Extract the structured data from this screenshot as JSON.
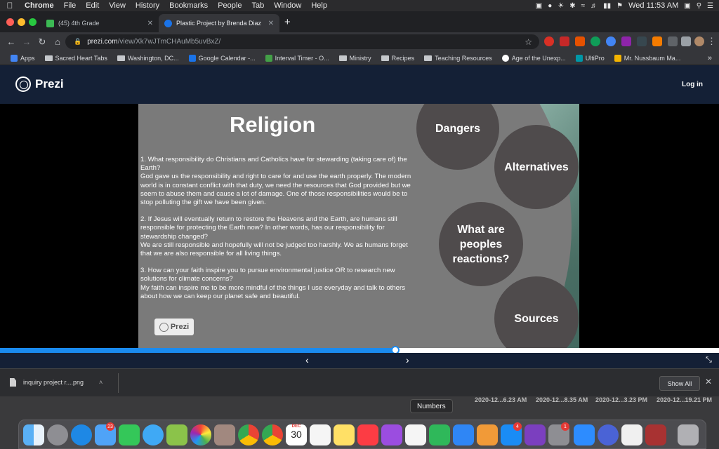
{
  "menubar": {
    "items": [
      "Chrome",
      "File",
      "Edit",
      "View",
      "History",
      "Bookmarks",
      "People",
      "Tab",
      "Window",
      "Help"
    ],
    "clock": "Wed 11:53 AM"
  },
  "tabs": [
    {
      "title": "(45) 4th Grade",
      "active": false,
      "color": "#3cba54"
    },
    {
      "title": "Plastic Project by Brenda Diaz",
      "active": true,
      "color": "#1a73e8"
    }
  ],
  "new_tab": "+",
  "address": {
    "host": "prezi.com",
    "path": "/view/Xk7wJTmCHAuMb5uvBxZ/"
  },
  "bookmarks": [
    {
      "label": "Apps",
      "icon": "apps-grid"
    },
    {
      "label": "Sacred Heart Tabs",
      "icon": "folder"
    },
    {
      "label": "Washington, DC...",
      "icon": "folder"
    },
    {
      "label": "Google Calendar -...",
      "icon": "calendar"
    },
    {
      "label": "Interval Timer - O...",
      "icon": "timer"
    },
    {
      "label": "Ministry",
      "icon": "folder"
    },
    {
      "label": "Recipes",
      "icon": "folder"
    },
    {
      "label": "Teaching Resources",
      "icon": "folder"
    },
    {
      "label": "Age of the Unexp...",
      "icon": "wikipedia"
    },
    {
      "label": "UltiPro",
      "icon": "ultipro"
    },
    {
      "label": "Mr. Nussbaum Ma...",
      "icon": "nussbaum"
    }
  ],
  "prezi": {
    "brand": "Prezi",
    "login": "Log in",
    "badge": "Prezi"
  },
  "slide": {
    "title": "Religion",
    "paragraphs": [
      "1. What responsibility do Christians and Catholics have for stewarding (taking care of) the Earth?\nGod gave us the responsibility and right to care for and use the earth properly. The modern world is in constant conflict with that duty, we need the resources that God provided but we seem to abuse them and cause a lot of damage. One of those responsibilities would be to stop polluting the gift we have been given.",
      "2. If Jesus will eventually return to restore the Heavens and the Earth, are humans still responsible for protecting the Earth now? In other words, has our responsibility for stewardship changed?\nWe are still responsible and hopefully will not be judged too harshly. We as humans forget that we are also responsible for all living things.",
      "3. How can your faith inspire you to pursue environmental justice OR to research new solutions for climate concerns?\nMy faith can inspire me to be more mindful of the things I use everyday and talk to others about how we can keep our planet safe and beautiful."
    ],
    "bubbles": [
      "Dangers",
      "Alternatives",
      "What are peoples reactions?",
      "Sources"
    ]
  },
  "progress": {
    "fraction": 0.55
  },
  "download": {
    "filename": "inquiry project r....png",
    "show_all": "Show All"
  },
  "desktop": {
    "screenshots": [
      "2020-12...6.23 AM",
      "2020-12...8.35 AM",
      "2020-12...3.23 PM",
      "2020-12...19.21 PM"
    ],
    "tooltip": "Numbers"
  },
  "dock": {
    "mail_badge": "23",
    "calendar_month": "DEC",
    "calendar_day": "30",
    "appstore_badge": "4",
    "settings_badge": "1"
  }
}
